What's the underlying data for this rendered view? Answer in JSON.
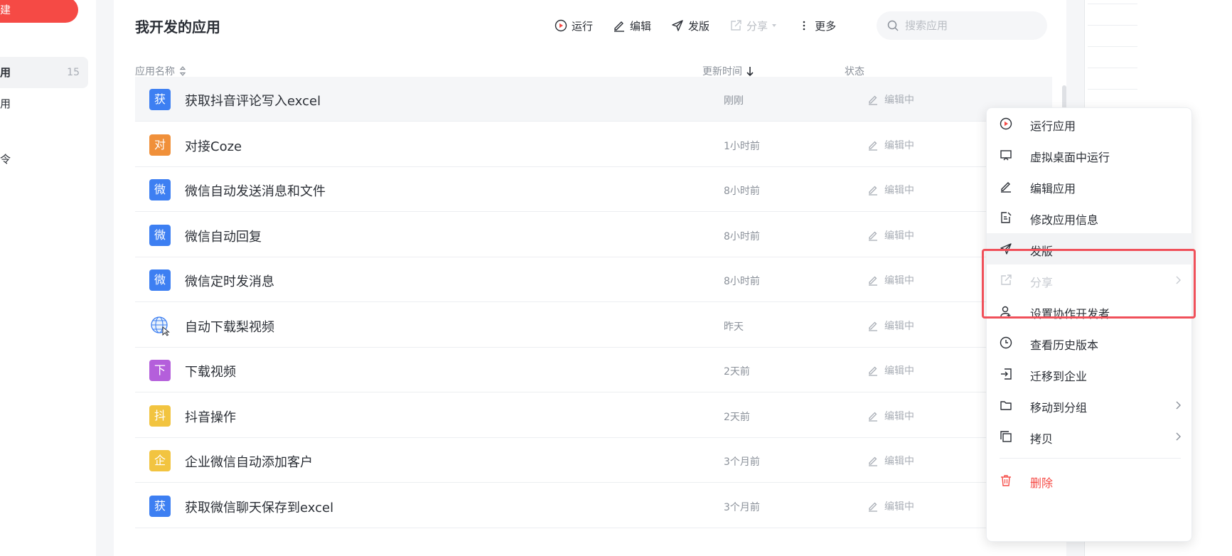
{
  "sidebar": {
    "new_label": "建",
    "items": [
      {
        "label": "用",
        "count": "15"
      },
      {
        "label": "用"
      },
      {
        "label": "令"
      }
    ]
  },
  "main": {
    "title": "我开发的应用",
    "toolbar": {
      "run": "运行",
      "edit": "编辑",
      "publish": "发版",
      "share": "分享",
      "more": "更多"
    },
    "search": {
      "placeholder": "搜索应用"
    },
    "columns": {
      "name": "应用名称",
      "updated": "更新时间",
      "status": "状态"
    },
    "rows": [
      {
        "icon_text": "获",
        "icon_color": "#3d7ff2",
        "name": "获取抖音评论写入excel",
        "time": "刚刚",
        "status": "编辑中"
      },
      {
        "icon_text": "对",
        "icon_color": "#f0903a",
        "name": "对接Coze",
        "time": "1小时前",
        "status": "编辑中"
      },
      {
        "icon_text": "微",
        "icon_color": "#3d7ff2",
        "name": "微信自动发送消息和文件",
        "time": "8小时前",
        "status": "编辑中"
      },
      {
        "icon_text": "微",
        "icon_color": "#3d7ff2",
        "name": "微信自动回复",
        "time": "8小时前",
        "status": "编辑中"
      },
      {
        "icon_text": "微",
        "icon_color": "#3d7ff2",
        "name": "微信定时发消息",
        "time": "8小时前",
        "status": "编辑中"
      },
      {
        "icon_text": "",
        "icon_color": "globe",
        "name": "自动下载梨视频",
        "time": "昨天",
        "status": "编辑中"
      },
      {
        "icon_text": "下",
        "icon_color": "#b45fdb",
        "name": "下载视频",
        "time": "2天前",
        "status": "编辑中"
      },
      {
        "icon_text": "抖",
        "icon_color": "#f2c440",
        "name": "抖音操作",
        "time": "2天前",
        "status": "编辑中"
      },
      {
        "icon_text": "企",
        "icon_color": "#f2c440",
        "name": "企业微信自动添加客户",
        "time": "3个月前",
        "status": "编辑中"
      },
      {
        "icon_text": "获",
        "icon_color": "#3d7ff2",
        "name": "获取微信聊天保存到excel",
        "time": "3个月前",
        "status": "编辑中"
      }
    ]
  },
  "context_menu": {
    "items": [
      {
        "label": "运行应用",
        "icon": "play-circle-icon"
      },
      {
        "label": "虚拟桌面中运行",
        "icon": "monitor-icon"
      },
      {
        "label": "编辑应用",
        "icon": "pencil-icon"
      },
      {
        "label": "修改应用信息",
        "icon": "edit-doc-icon"
      },
      {
        "label": "发版",
        "icon": "send-icon"
      },
      {
        "label": "分享",
        "icon": "share-icon"
      },
      {
        "label": "设置协作开发者",
        "icon": "user-add-icon"
      },
      {
        "label": "查看历史版本",
        "icon": "clock-icon"
      },
      {
        "label": "迁移到企业",
        "icon": "login-icon"
      },
      {
        "label": "移动到分组",
        "icon": "folder-icon"
      },
      {
        "label": "拷贝",
        "icon": "copy-icon"
      },
      {
        "label": "删除",
        "icon": "trash-icon"
      }
    ]
  },
  "colors": {
    "accent_red": "#f54a45",
    "brand_blue": "#3d7ff2",
    "highlight_box": "#f0505a"
  }
}
